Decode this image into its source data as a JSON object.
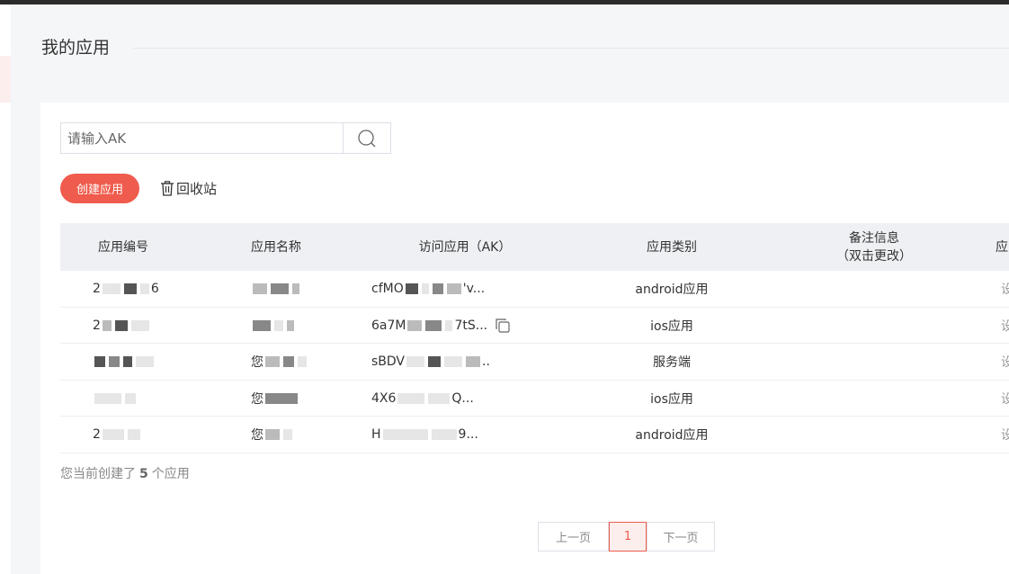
{
  "page": {
    "title": "我的应用"
  },
  "search": {
    "placeholder": "请输入AK"
  },
  "toolbar": {
    "create_label": "创建应用",
    "recycle_label": "回收站"
  },
  "table": {
    "headers": [
      "应用编号",
      "应用名称",
      "访问应用（AK）",
      "应用类别",
      "备注信息",
      "（双击更改）",
      "应"
    ],
    "rows": [
      {
        "id": "2",
        "id_tail": "6",
        "name": "",
        "ak": "cfMO",
        "ak_tail": "'v...",
        "type": "android应用",
        "op": "设"
      },
      {
        "id": "2",
        "id_tail": "",
        "name": "",
        "ak": "6a7M",
        "ak_tail": "7tS...",
        "type": "ios应用",
        "op": "设"
      },
      {
        "id": "",
        "id_tail": "",
        "name": "您",
        "ak": "sBDV",
        "ak_tail": "..",
        "type": "服务端",
        "op": "设"
      },
      {
        "id": "",
        "id_tail": "",
        "name": "您",
        "ak": "4X6",
        "ak_tail": "Q...",
        "type": "ios应用",
        "op": "设"
      },
      {
        "id": "2",
        "id_tail": "",
        "name": "您",
        "ak": "H",
        "ak_tail": "9...",
        "type": "android应用",
        "op": "设"
      }
    ]
  },
  "summary": {
    "prefix": "您当前创建了",
    "count": "5",
    "suffix": "个应用"
  },
  "pagination": {
    "prev": "上一页",
    "current": "1",
    "next": "下一页"
  },
  "colors": {
    "accent": "#ef5b4c",
    "header_bg": "#eef0f3"
  }
}
